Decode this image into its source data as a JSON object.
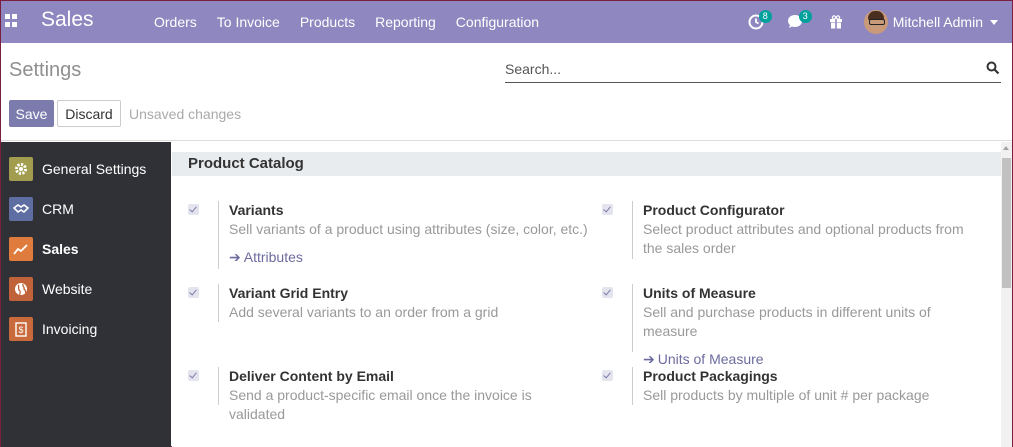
{
  "nav": {
    "brand": "Sales",
    "menu": [
      "Orders",
      "To Invoice",
      "Products",
      "Reporting",
      "Configuration"
    ],
    "activity_count": "8",
    "messages_count": "3",
    "user_name": "Mitchell Admin"
  },
  "control": {
    "title": "Settings",
    "search_placeholder": "Search...",
    "save_label": "Save",
    "discard_label": "Discard",
    "status": "Unsaved changes"
  },
  "sidebar": {
    "items": [
      {
        "label": "General Settings",
        "icon": "gear-icon",
        "color": "#a29d4e"
      },
      {
        "label": "CRM",
        "icon": "handshake-icon",
        "color": "#5e6ea2"
      },
      {
        "label": "Sales",
        "icon": "chart-icon",
        "color": "#e07b3e"
      },
      {
        "label": "Website",
        "icon": "globe-icon",
        "color": "#c0633a"
      },
      {
        "label": "Invoicing",
        "icon": "invoice-icon",
        "color": "#c86a3c"
      }
    ],
    "active": "Sales"
  },
  "section": {
    "title": "Product Catalog",
    "settings": [
      {
        "title": "Variants",
        "desc": "Sell variants of a product using attributes (size, color, etc.)",
        "link": "Attributes"
      },
      {
        "title": "Product Configurator",
        "desc": "Select product attributes and optional products from the sales order",
        "link": ""
      },
      {
        "title": "Variant Grid Entry",
        "desc": "Add several variants to an order from a grid",
        "link": ""
      },
      {
        "title": "Units of Measure",
        "desc": "Sell and purchase products in different units of measure",
        "link": "Units of Measure"
      },
      {
        "title": "Deliver Content by Email",
        "desc": "Send a product-specific email once the invoice is validated",
        "link": ""
      },
      {
        "title": "Product Packagings",
        "desc": "Sell products by multiple of unit # per package",
        "link": ""
      }
    ]
  },
  "colors": {
    "nav_bg": "#8f87bf",
    "accent": "#7c7bad",
    "sidebar_bg": "#2f3136",
    "badge": "#00a09d"
  }
}
